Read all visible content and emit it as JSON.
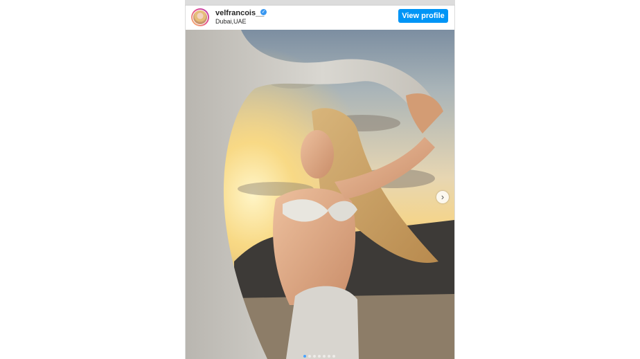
{
  "post": {
    "username": "velfrancois__",
    "location": "Dubai,UAE",
    "view_profile_label": "View profile",
    "verified_icon": "verified-badge-icon",
    "carousel": {
      "total_slides": 7,
      "active_slide": 1,
      "next_icon": "chevron-right-icon"
    }
  },
  "colors": {
    "button": "#0095f6",
    "verified": "#3897f0",
    "active_dot": "#4aa3ff"
  }
}
